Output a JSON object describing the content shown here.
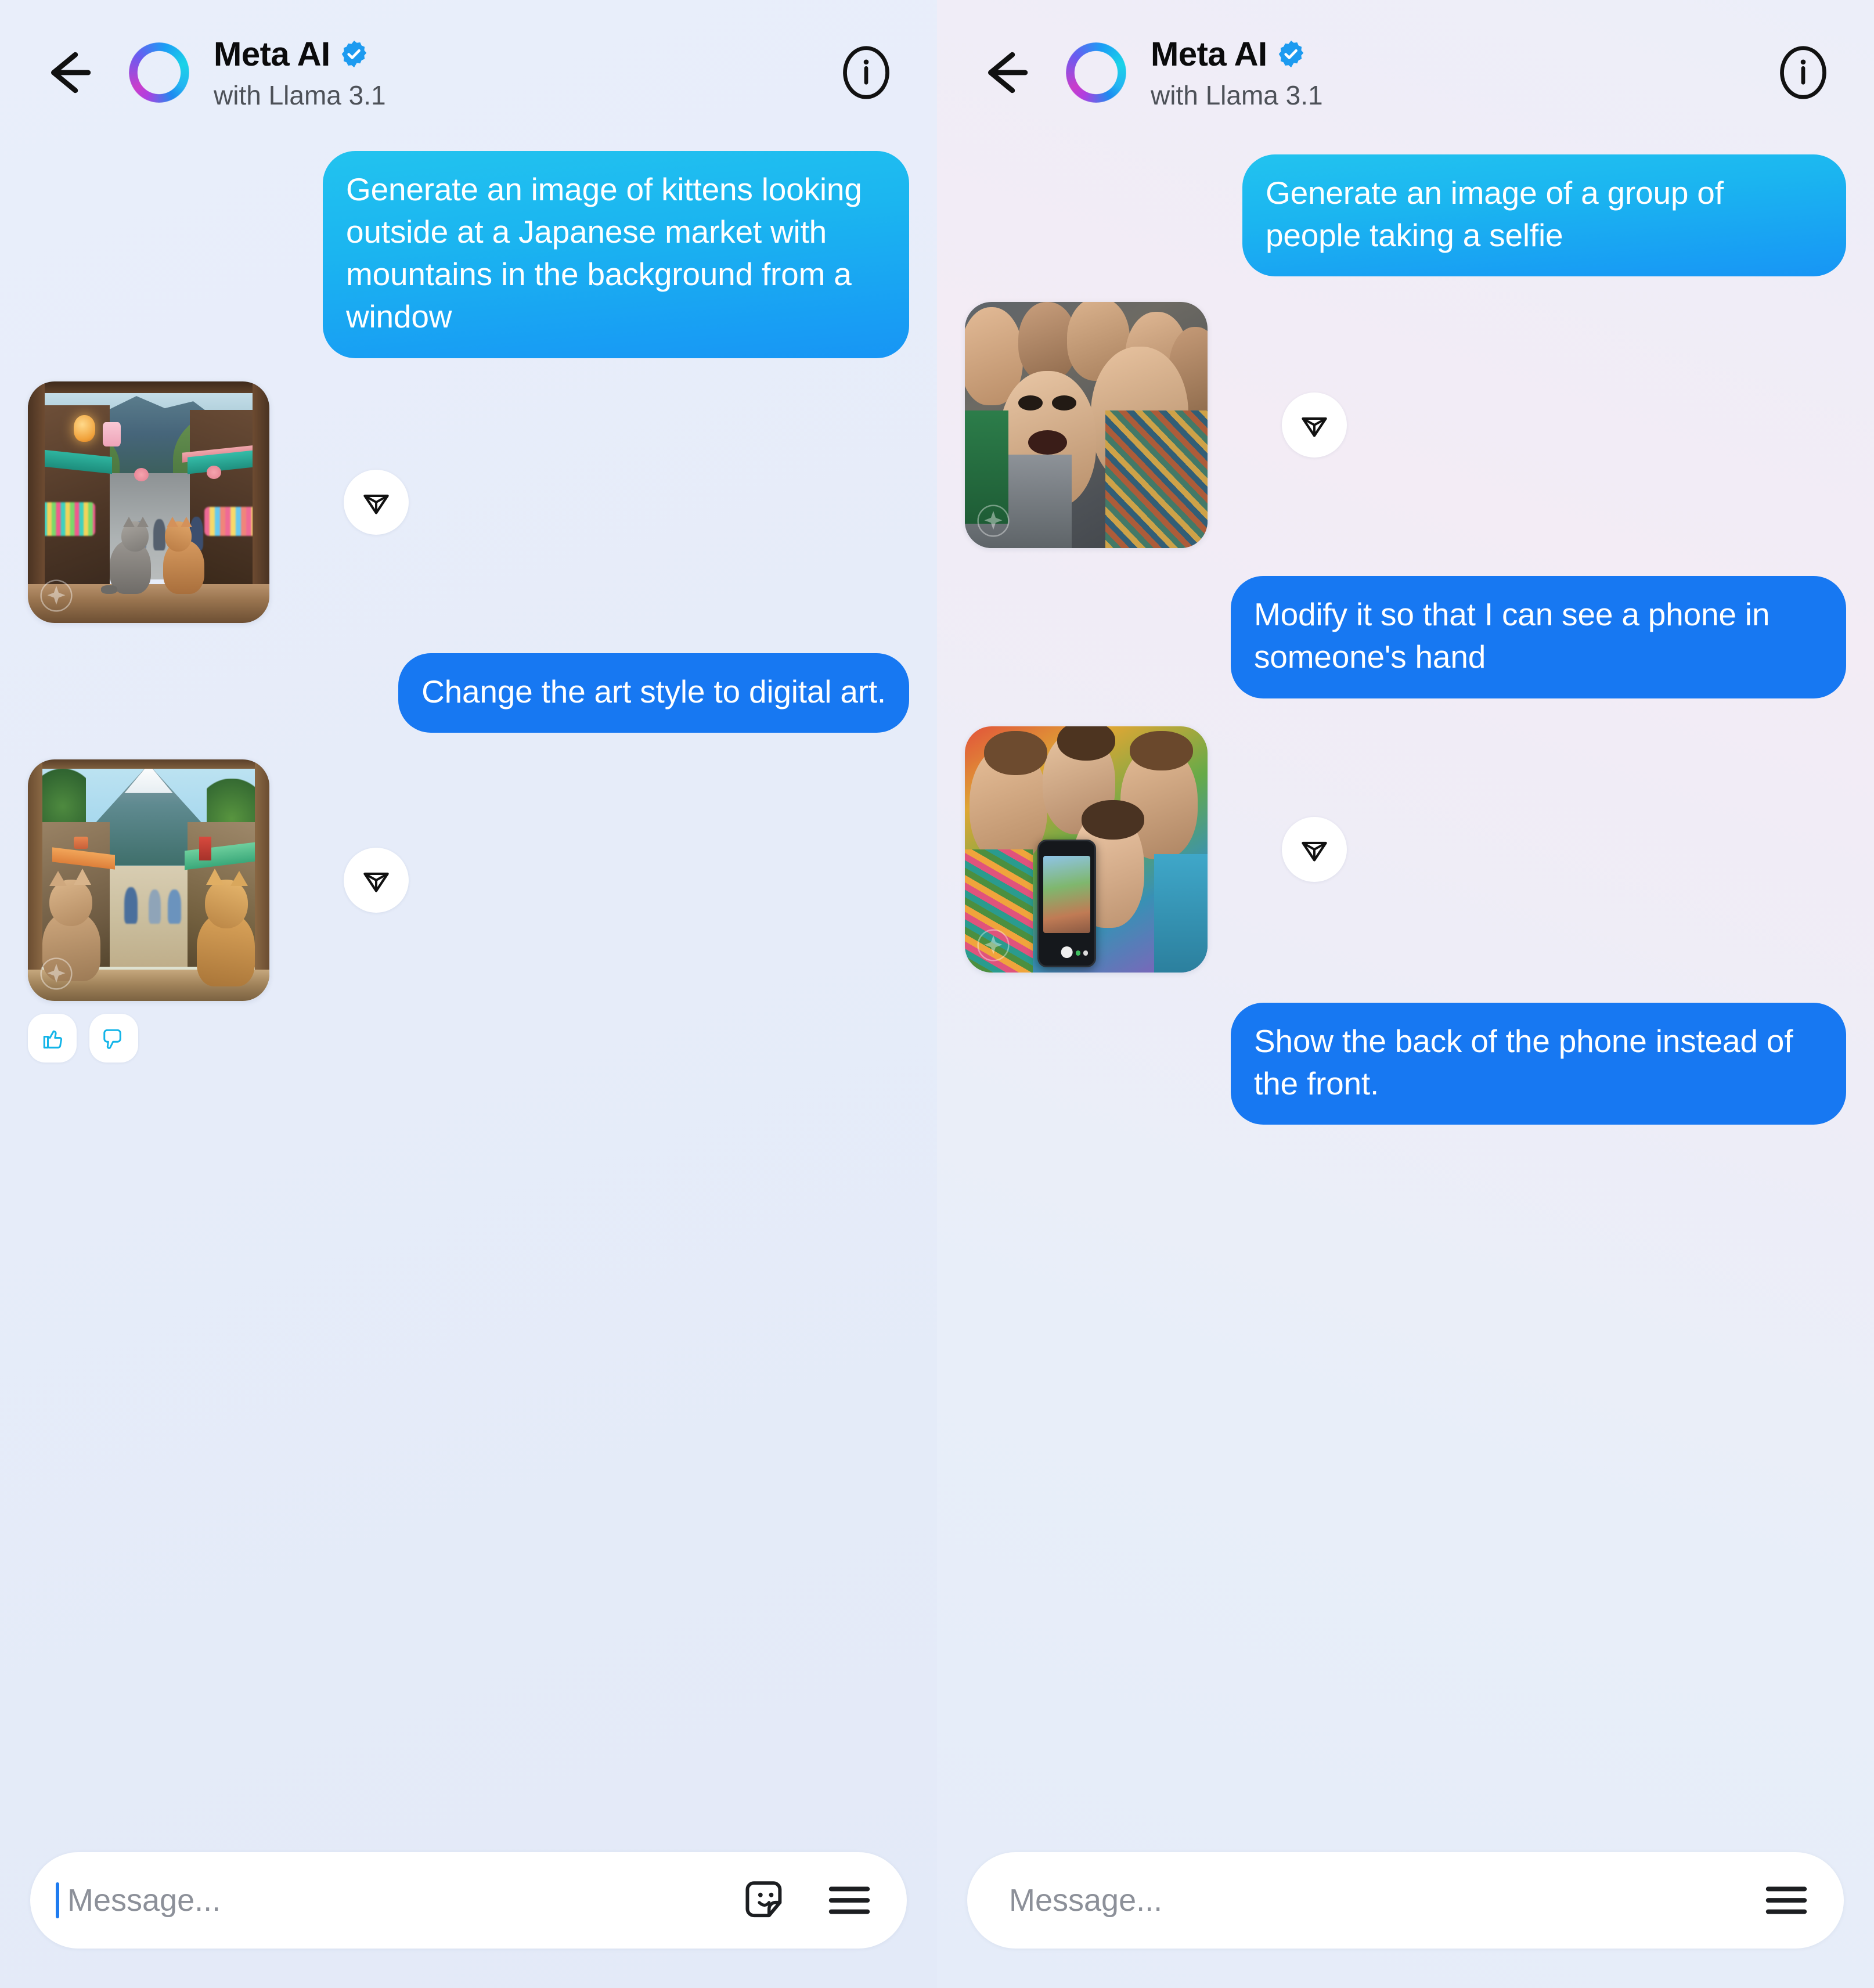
{
  "app": {
    "name": "Meta AI chat",
    "layout": "side-by-side comparison of two chat threads"
  },
  "colors": {
    "background": "#e9eefa",
    "bubble_gradient_start": "#22c3ef",
    "bubble_gradient_end": "#1795f5",
    "bubble_solid": "#1778f2",
    "bubble_text": "#ffffff",
    "accent_blue": "#1877f2",
    "reaction_icon": "#12b4e8",
    "verified_badge": "#1d9bf0",
    "placeholder_text": "#8c9099",
    "caret": "#1f7cf0"
  },
  "header": {
    "back_icon": "back-arrow-icon",
    "logo_icon": "meta-ai-ring-logo",
    "title": "Meta AI",
    "verified_icon": "verified-badge-icon",
    "subtitle": "with Llama 3.1",
    "info_icon": "info-circle-icon"
  },
  "composer": {
    "placeholder": "Message...",
    "sticker_icon": "sticker-smiley-icon",
    "menu_icon": "hamburger-menu-icon",
    "caret_visible_left": true,
    "caret_visible_right": false
  },
  "icons": {
    "share": "share-send-icon",
    "thumbs_up": "thumbs-up-icon",
    "thumbs_down": "thumbs-down-icon",
    "watermark": "meta-ai-imagine-watermark"
  },
  "left_panel": {
    "messages": [
      {
        "type": "text",
        "direction": "outgoing",
        "style": "gradient",
        "text": "Generate an image of kittens looking outside at a Japanese market with mountains in the background from a window"
      },
      {
        "type": "image",
        "direction": "incoming",
        "alt": "Photorealistic image of two kittens sitting on a wooden window sill looking out at a Japanese market street with mountains in the background",
        "has_share_button": true,
        "has_watermark": true
      },
      {
        "type": "text",
        "direction": "outgoing",
        "style": "solid",
        "text": "Change the art style to digital art."
      },
      {
        "type": "image",
        "direction": "incoming",
        "alt": "Digital art / anime style image of two kittens seen from behind at a window looking out at a Japanese market street with a snow-capped mountain",
        "has_share_button": true,
        "has_watermark": true,
        "has_reactions": true
      }
    ]
  },
  "right_panel": {
    "messages": [
      {
        "type": "text",
        "direction": "outgoing",
        "style": "gradient",
        "text": "Generate an image of a group of people taking a selfie"
      },
      {
        "type": "image",
        "direction": "incoming",
        "alt": "Photorealistic image of a group of excited men crowded together taking a selfie with open mouths",
        "has_share_button": true,
        "has_watermark": true
      },
      {
        "type": "text",
        "direction": "outgoing",
        "style": "solid",
        "text": "Modify it so that I can see a phone in someone's hand"
      },
      {
        "type": "image",
        "direction": "incoming",
        "alt": "Colorful image of a group of smiling friends taking a selfie with a smartphone held up showing the camera screen",
        "has_share_button": true,
        "has_watermark": true
      },
      {
        "type": "text",
        "direction": "outgoing",
        "style": "solid",
        "text": "Show the back of the phone instead of the front."
      }
    ]
  }
}
